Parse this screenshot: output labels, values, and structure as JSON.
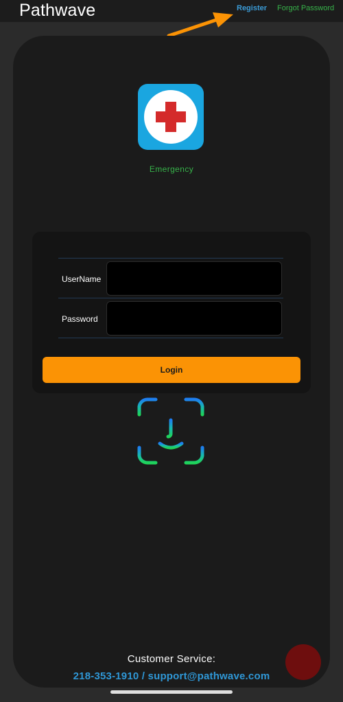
{
  "header": {
    "title": "Pathwave",
    "register_label": "Register",
    "forgot_password_label": "Forgot Password"
  },
  "app_icon": {
    "icon": "red-cross-icon",
    "label": "Emergency"
  },
  "login_form": {
    "username_label": "UserName",
    "username_value": "",
    "password_label": "Password",
    "password_value": "",
    "login_button_label": "Login"
  },
  "biometric": {
    "icon": "face-id-icon"
  },
  "footer": {
    "customer_service_label": "Customer Service:",
    "contact": "218-353-1910 / support@pathwave.com"
  },
  "colors": {
    "accent_orange": "#fb9305",
    "link_blue": "#3b9bd6",
    "link_green": "#37b34a",
    "card_bg": "#1b1b1b"
  }
}
